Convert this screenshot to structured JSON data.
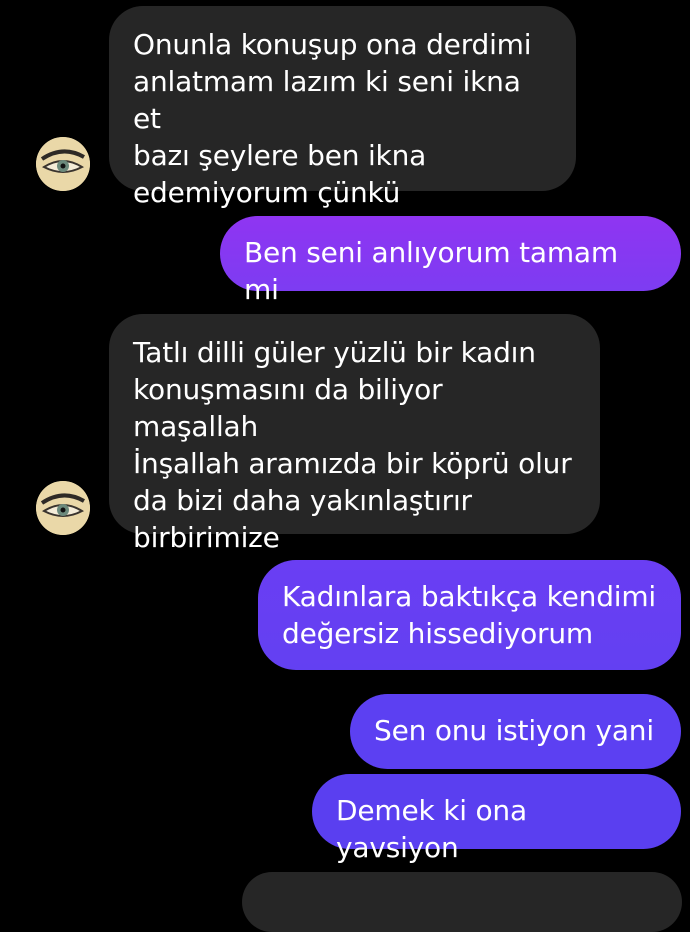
{
  "thread": {
    "colors": {
      "background": "#000000",
      "incoming_bubble": "#262626",
      "outgoing_gradient_top": "#8a3cf0",
      "outgoing_gradient_bottom": "#5c40f2"
    },
    "messages": [
      {
        "direction": "incoming",
        "text": "Onunla konuşup ona derdimi\nanlatmam lazım ki seni ikna et\nbazı şeylere ben ikna\nedemiyorum çünkü",
        "avatar_icon": "eye-icon"
      },
      {
        "direction": "outgoing",
        "text": "Ben seni anlıyorum tamam mi"
      },
      {
        "direction": "incoming",
        "text": "Tatlı dilli güler yüzlü bir kadın\nkonuşmasını da biliyor maşallah\nİnşallah aramızda bir köprü olur\nda bizi daha yakınlaştırır\nbirbirimize",
        "avatar_icon": "eye-icon"
      },
      {
        "direction": "outgoing",
        "text": "Kadınlara baktıkça kendimi\ndeğersiz hissediyorum"
      },
      {
        "direction": "outgoing",
        "text": "Sen onu istiyon yani"
      },
      {
        "direction": "outgoing",
        "text": "Demek ki ona yavsiyon"
      },
      {
        "direction": "incoming",
        "text": ""
      }
    ]
  }
}
